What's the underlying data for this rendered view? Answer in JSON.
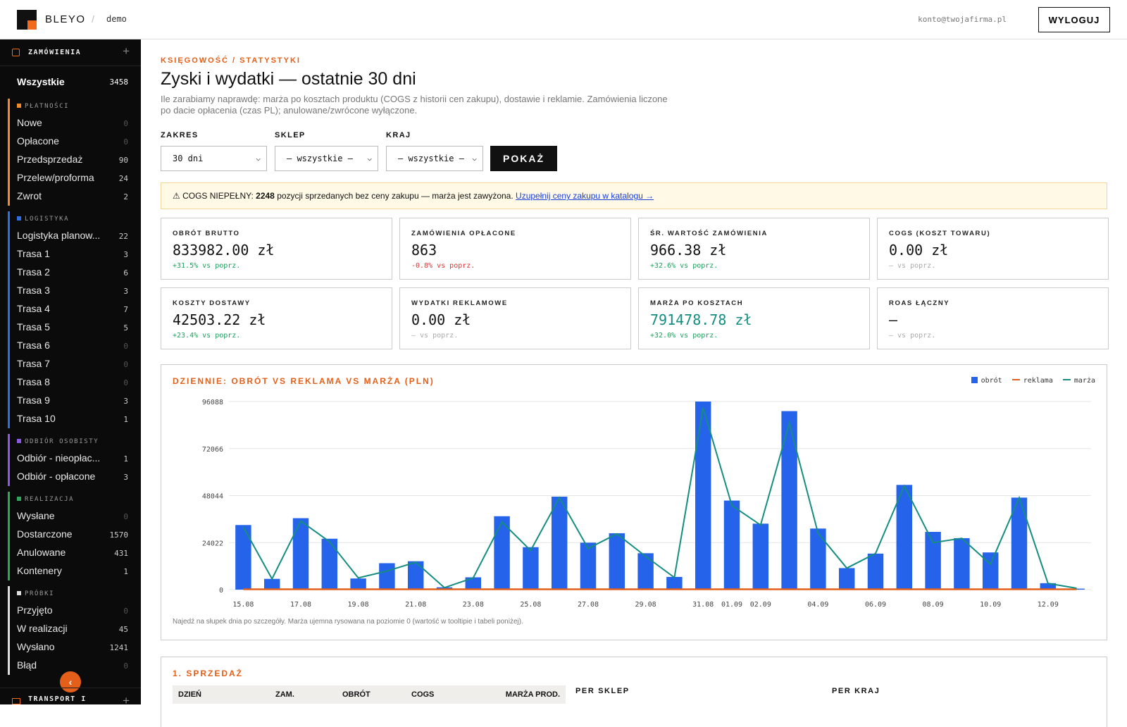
{
  "topbar": {
    "brand": "BLEYO",
    "separator": "/",
    "env": "demo",
    "email": "konto@twojafirma.pl",
    "logout": "WYLOGUJ"
  },
  "sidebar": {
    "header": "ZAMÓWIENIA",
    "all": {
      "label": "Wszystkie",
      "count": "3458"
    },
    "groups": [
      {
        "title": "PŁATNOŚCI",
        "color": "#f28c28",
        "items": [
          {
            "label": "Nowe",
            "count": "0"
          },
          {
            "label": "Opłacone",
            "count": "0"
          },
          {
            "label": "Przedsprzedaż",
            "count": "90"
          },
          {
            "label": "Przelew/proforma",
            "count": "24"
          },
          {
            "label": "Zwrot",
            "count": "2"
          }
        ]
      },
      {
        "title": "LOGISTYKA",
        "color": "#2f6fdf",
        "items": [
          {
            "label": "Logistyka planow...",
            "count": "22"
          },
          {
            "label": "Trasa 1",
            "count": "3"
          },
          {
            "label": "Trasa 2",
            "count": "6"
          },
          {
            "label": "Trasa 3",
            "count": "3"
          },
          {
            "label": "Trasa 4",
            "count": "7"
          },
          {
            "label": "Trasa 5",
            "count": "5"
          },
          {
            "label": "Trasa 6",
            "count": "0"
          },
          {
            "label": "Trasa 7",
            "count": "0"
          },
          {
            "label": "Trasa 8",
            "count": "0"
          },
          {
            "label": "Trasa 9",
            "count": "3"
          },
          {
            "label": "Trasa 10",
            "count": "1"
          }
        ]
      },
      {
        "title": "ODBIÓR OSOBISTY",
        "color": "#8a5be0",
        "items": [
          {
            "label": "Odbiór - nieopłac...",
            "count": "1"
          },
          {
            "label": "Odbiór - opłacone",
            "count": "3"
          }
        ]
      },
      {
        "title": "REALIZACJA",
        "color": "#2fa85a",
        "items": [
          {
            "label": "Wysłane",
            "count": "0"
          },
          {
            "label": "Dostarczone",
            "count": "1570"
          },
          {
            "label": "Anulowane",
            "count": "431"
          },
          {
            "label": "Kontenery",
            "count": "1"
          }
        ]
      },
      {
        "title": "PRÓBKI",
        "color": "#dddddd",
        "items": [
          {
            "label": "Przyjęto",
            "count": "0"
          },
          {
            "label": "W realizacji",
            "count": "45"
          },
          {
            "label": "Wysłano",
            "count": "1241"
          },
          {
            "label": "Błąd",
            "count": "0"
          }
        ]
      }
    ],
    "footer": "TRANSPORT I"
  },
  "page": {
    "breadcrumb": "KSIĘGOWOŚĆ / STATYSTYKI",
    "title": "Zyski i wydatki — ostatnie 30 dni",
    "description": "Ile zarabiamy naprawdę: marża po kosztach produktu (COGS z historii cen zakupu), dostawie i reklamie. Zamówienia liczone po dacie opłacenia (czas PL); anulowane/zwrócone wyłączone."
  },
  "filters": {
    "range_label": "ZAKRES",
    "range_value": "30 dni",
    "shop_label": "SKLEP",
    "shop_value": "— wszystkie —",
    "country_label": "KRAJ",
    "country_value": "— wszystkie —",
    "show_button": "POKAŻ"
  },
  "warning": {
    "prefix": "⚠ COGS NIEPEŁNY:",
    "count": "2248",
    "text": "pozycji sprzedanych bez ceny zakupu — marża jest zawyżona.",
    "link": "Uzupełnij ceny zakupu w katalogu →"
  },
  "kpis": [
    {
      "label": "OBRÓT BRUTTO",
      "value": "833982.00 zł",
      "delta": "+31.5% vs poprz.",
      "trend": "up"
    },
    {
      "label": "ZAMÓWIENIA OPŁACONE",
      "value": "863",
      "delta": "-0.8% vs poprz.",
      "trend": "down"
    },
    {
      "label": "ŚR. WARTOŚĆ ZAMÓWIENIA",
      "value": "966.38 zł",
      "delta": "+32.6% vs poprz.",
      "trend": "up"
    },
    {
      "label": "COGS (KOSZT TOWARU)",
      "value": "0.00 zł",
      "delta": "— vs poprz.",
      "trend": "none"
    },
    {
      "label": "KOSZTY DOSTAWY",
      "value": "42503.22 zł",
      "delta": "+23.4% vs poprz.",
      "trend": "up"
    },
    {
      "label": "WYDATKI REKLAMOWE",
      "value": "0.00 zł",
      "delta": "— vs poprz.",
      "trend": "none"
    },
    {
      "label": "MARŻA PO KOSZTACH",
      "value": "791478.78 zł",
      "delta": "+32.0% vs poprz.",
      "trend": "up",
      "highlight": true
    },
    {
      "label": "ROAS ŁĄCZNY",
      "value": "—",
      "delta": "— vs poprz.",
      "trend": "none"
    }
  ],
  "chart": {
    "title": "DZIENNIE: OBRÓT VS REKLAMA VS MARŻA (PLN)",
    "note": "Najedź na słupek dnia po szczegóły. Marża ujemna rysowana na poziomie 0 (wartość w tooltipie i tabeli poniżej).",
    "legend": [
      "obrót",
      "reklama",
      "marża"
    ]
  },
  "chart_data": {
    "type": "bar",
    "categories": [
      "15.08",
      "16.08",
      "17.08",
      "18.08",
      "19.08",
      "20.08",
      "21.08",
      "22.08",
      "23.08",
      "24.08",
      "25.08",
      "26.08",
      "27.08",
      "28.08",
      "29.08",
      "30.08",
      "31.08",
      "01.09",
      "02.09",
      "03.09",
      "04.09",
      "05.09",
      "06.09",
      "07.09",
      "08.09",
      "09.09",
      "10.09",
      "11.09",
      "12.09",
      "13.09"
    ],
    "x_tick_labels": [
      "15.08",
      "17.08",
      "19.08",
      "21.08",
      "23.08",
      "25.08",
      "27.08",
      "29.08",
      "31.08",
      "01.09",
      "02.09",
      "04.09",
      "06.09",
      "08.09",
      "10.09",
      "12.09"
    ],
    "y_ticks": [
      "0",
      "24022",
      "48044",
      "72066",
      "96088"
    ],
    "ylim": [
      0,
      96088
    ],
    "series": [
      {
        "name": "obrót",
        "kind": "bar",
        "color": "#2563eb",
        "values": [
          33000,
          5500,
          36500,
          26000,
          5700,
          13500,
          14500,
          1200,
          6300,
          37500,
          21700,
          47500,
          24000,
          28800,
          18600,
          6500,
          96088,
          45500,
          33700,
          91200,
          31200,
          11000,
          18400,
          53500,
          29500,
          26300,
          19000,
          47000,
          3300,
          500
        ]
      },
      {
        "name": "reklama",
        "kind": "line",
        "color": "#e4601a",
        "values": [
          0,
          0,
          0,
          0,
          0,
          0,
          0,
          0,
          0,
          0,
          0,
          0,
          0,
          0,
          0,
          0,
          0,
          0,
          0,
          0,
          0,
          0,
          0,
          0,
          0,
          0,
          0,
          0,
          0,
          0
        ]
      },
      {
        "name": "marża",
        "kind": "line",
        "color": "#158d80",
        "values": [
          32000,
          5500,
          35000,
          24500,
          6000,
          9500,
          14000,
          1000,
          6000,
          34500,
          20000,
          47000,
          21000,
          28500,
          17000,
          6200,
          93000,
          43000,
          33000,
          85000,
          28800,
          11000,
          18500,
          53000,
          24000,
          26200,
          13000,
          47000,
          3200,
          700
        ]
      }
    ]
  },
  "sales": {
    "title": "1. SPRZEDAŻ",
    "columns": [
      "DZIEŃ",
      "ZAM.",
      "OBRÓT",
      "COGS",
      "MARŻA PROD."
    ],
    "per_shop": "PER SKLEP",
    "per_country": "PER KRAJ"
  }
}
